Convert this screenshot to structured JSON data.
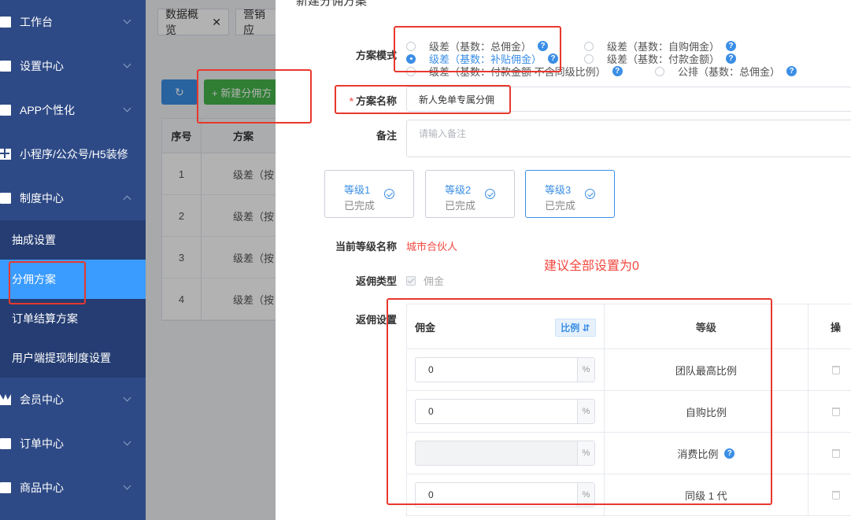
{
  "sidebar": {
    "items": [
      {
        "label": "工作台",
        "icon": "home-icon"
      },
      {
        "label": "设置中心",
        "icon": "folder-icon"
      },
      {
        "label": "APP个性化",
        "icon": "phone-icon"
      },
      {
        "label": "小程序/公众号/H5装修",
        "icon": "grid-icon"
      },
      {
        "label": "制度中心",
        "icon": "doc-icon"
      }
    ],
    "sub_items": [
      "抽成设置",
      "分佣方案",
      "订单结算方案",
      "用户端提现制度设置"
    ],
    "bottom_items": [
      {
        "label": "会员中心",
        "icon": "crown-icon"
      },
      {
        "label": "订单中心",
        "icon": "doc-icon"
      },
      {
        "label": "商品中心",
        "icon": "bag-icon"
      }
    ],
    "bg_color": "#2e4a86",
    "active_color": "#3b9cff"
  },
  "tabs": [
    "数据概览",
    "营销应"
  ],
  "toolbar": {
    "refresh_icon": "↻",
    "new_label": "+ 新建分佣方"
  },
  "list_table": {
    "headers": [
      "序号",
      "方案"
    ],
    "rows": [
      [
        "1",
        "级差（按"
      ],
      [
        "2",
        "级差（按"
      ],
      [
        "3",
        "级差（按"
      ],
      [
        "4",
        "级差（按"
      ]
    ]
  },
  "drawer": {
    "title": "新建分佣方案",
    "mode_label": "方案模式",
    "modes": [
      {
        "label": "级差（基数：总佣金）",
        "checked": false
      },
      {
        "label": "级差（基数：自购佣金）",
        "checked": false
      },
      {
        "label": "级差（基数：补贴佣金）",
        "checked": true
      },
      {
        "label": "级差（基数：付款金额）",
        "checked": false
      },
      {
        "label": "级差（基数：付款金额 不含同级比例）",
        "checked": false
      },
      {
        "label": "公排（基数：总佣金）",
        "checked": false
      }
    ],
    "name_label": "方案名称",
    "name_value": "新人免单专属分佣",
    "remark_label": "备注",
    "remark_placeholder": "请输入备注",
    "levels": [
      {
        "name": "等级1",
        "status": "已完成"
      },
      {
        "name": "等级2",
        "status": "已完成"
      },
      {
        "name": "等级3",
        "status": "已完成"
      }
    ],
    "current_level_label": "当前等级名称",
    "current_level_value": "城市合伙人",
    "note": "建议全部设置为0",
    "rebate_type_label": "返佣类型",
    "rebate_type_value": "佣金",
    "rebate_setting_label": "返佣设置",
    "table": {
      "col_commission": "佣金",
      "ratio_badge": "比例 ⇵",
      "col_level": "等级",
      "col_op": "操",
      "rows": [
        {
          "value": "0",
          "unit": "%",
          "level": "团队最高比例",
          "disabled": false,
          "help": false
        },
        {
          "value": "0",
          "unit": "%",
          "level": "自购比例",
          "disabled": false,
          "help": false
        },
        {
          "value": "",
          "unit": "%",
          "level": "消费比例",
          "disabled": true,
          "help": true
        },
        {
          "value": "0",
          "unit": "%",
          "level": "同级 1 代",
          "disabled": false,
          "help": false
        }
      ]
    }
  },
  "accent_color": "#3a8ee6",
  "annotation_color": "#e8382d"
}
